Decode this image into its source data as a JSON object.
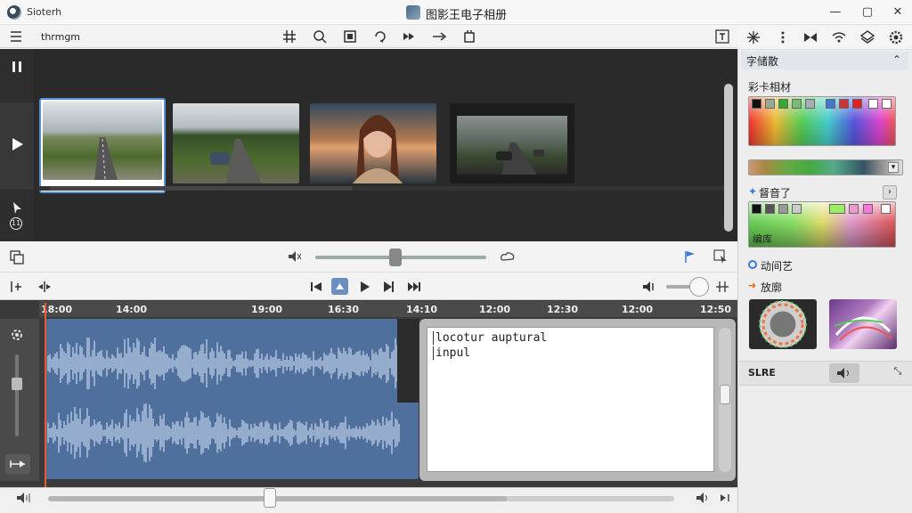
{
  "titlebar": {
    "app_menu": "Sioterh",
    "title": "图影王电子相册",
    "minimize": "—",
    "maximize": "▢",
    "close": "✕"
  },
  "toolbar": {
    "doc_name": "thrmgm"
  },
  "gallery": {
    "thumbnails": [
      {
        "name": "road-landscape",
        "selected": true
      },
      {
        "name": "car-forest-road",
        "selected": false
      },
      {
        "name": "woman-sunset",
        "selected": false
      },
      {
        "name": "dark-road-cars",
        "selected": false
      }
    ]
  },
  "timeline": {
    "ticks": [
      "18:00",
      "14:00",
      "19:00",
      "16:30",
      "14:10",
      "12:00",
      "12:30",
      "12:00",
      "12:50"
    ]
  },
  "text_editor": {
    "line1": "locotur auptural",
    "line2": "inpul"
  },
  "right_panel": {
    "header": "字储散",
    "section1": "彩卡相材",
    "section2": "督音了",
    "section2_sub": "编库",
    "section3": "动间艺",
    "section4": "放廓",
    "footer_label": "SLRE"
  },
  "colors": {
    "accent": "#4f6f9c",
    "playhead": "#e53",
    "dark_bg": "#2a2a2a"
  }
}
